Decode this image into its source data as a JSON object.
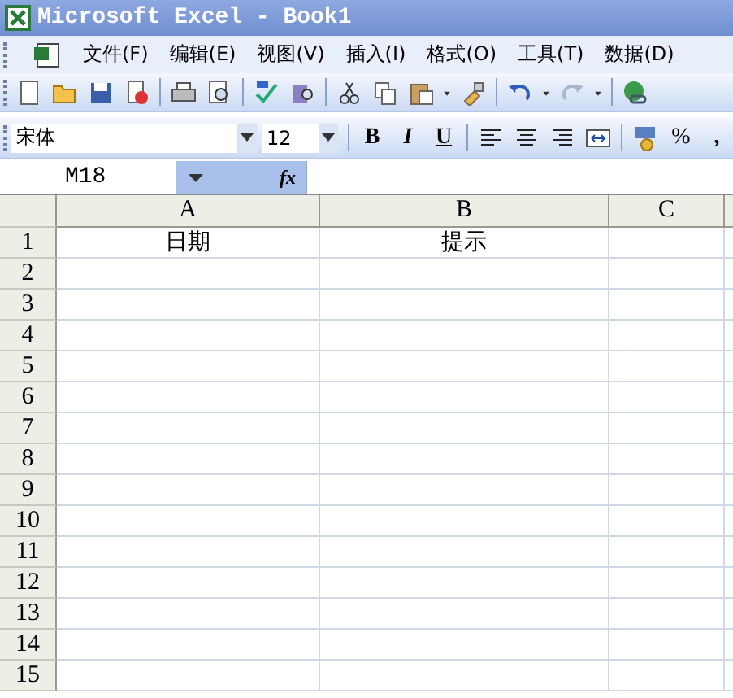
{
  "window": {
    "title": "Microsoft Excel - Book1"
  },
  "menu": {
    "items": [
      "文件(F)",
      "编辑(E)",
      "视图(V)",
      "插入(I)",
      "格式(O)",
      "工具(T)",
      "数据(D)"
    ]
  },
  "standard_toolbar": [
    {
      "kind": "new"
    },
    {
      "kind": "open"
    },
    {
      "kind": "save"
    },
    {
      "kind": "permission"
    },
    {
      "kind": "sep"
    },
    {
      "kind": "print"
    },
    {
      "kind": "preview"
    },
    {
      "kind": "sep"
    },
    {
      "kind": "spelling"
    },
    {
      "kind": "research"
    },
    {
      "kind": "sep"
    },
    {
      "kind": "cut"
    },
    {
      "kind": "copy"
    },
    {
      "kind": "paste"
    },
    {
      "kind": "caret"
    },
    {
      "kind": "brush"
    },
    {
      "kind": "sep"
    },
    {
      "kind": "undo"
    },
    {
      "kind": "caret"
    },
    {
      "kind": "redo"
    },
    {
      "kind": "caret"
    },
    {
      "kind": "sep"
    },
    {
      "kind": "link"
    }
  ],
  "formatting_toolbar": {
    "font": "宋体",
    "size": "12",
    "buttons": [
      {
        "kind": "bold",
        "label": "B"
      },
      {
        "kind": "italic",
        "label": "I"
      },
      {
        "kind": "underline",
        "label": "U"
      },
      {
        "kind": "sep"
      },
      {
        "kind": "align-left"
      },
      {
        "kind": "align-center"
      },
      {
        "kind": "align-right"
      },
      {
        "kind": "merge"
      },
      {
        "kind": "sep"
      },
      {
        "kind": "currency"
      },
      {
        "kind": "percent",
        "label": "%"
      },
      {
        "kind": "comma",
        "label": ","
      }
    ]
  },
  "formula_bar": {
    "name_box": "M18",
    "fx": "fx"
  },
  "sheet": {
    "columns": [
      "A",
      "B",
      "C"
    ],
    "rows": [
      {
        "header": "1",
        "cells": [
          "日期",
          "提示"
        ]
      },
      {
        "header": "2",
        "cells": []
      },
      {
        "header": "3",
        "cells": []
      },
      {
        "header": "4",
        "cells": []
      },
      {
        "header": "5",
        "cells": []
      },
      {
        "header": "6",
        "cells": []
      },
      {
        "header": "7",
        "cells": []
      },
      {
        "header": "8",
        "cells": []
      },
      {
        "header": "9",
        "cells": []
      },
      {
        "header": "10",
        "cells": []
      },
      {
        "header": "11",
        "cells": []
      },
      {
        "header": "12",
        "cells": []
      },
      {
        "header": "13",
        "cells": []
      },
      {
        "header": "14",
        "cells": []
      },
      {
        "header": "15",
        "cells": []
      }
    ]
  }
}
